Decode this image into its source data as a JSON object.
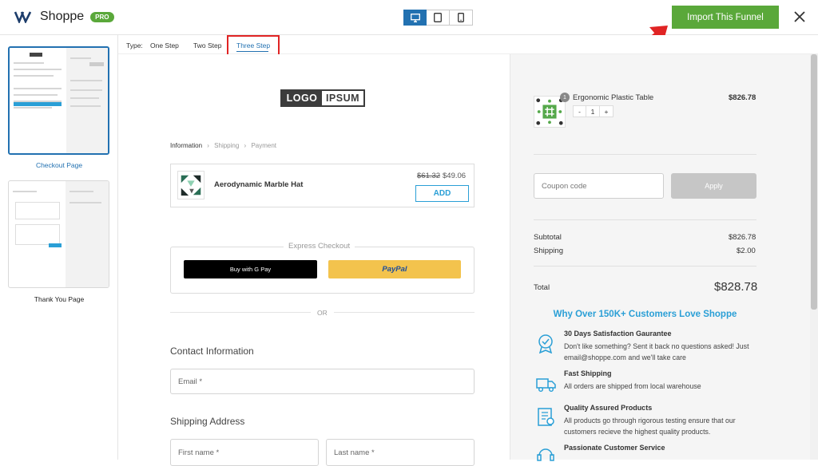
{
  "app": {
    "name": "Shoppe",
    "badge": "PRO"
  },
  "toolbar": {
    "import_label": "Import This Funnel"
  },
  "templates": [
    {
      "label": "Checkout Page",
      "selected": true
    },
    {
      "label": "Thank You Page",
      "selected": false
    }
  ],
  "typebar": {
    "label": "Type:",
    "tabs": [
      "One Step",
      "Two Step",
      "Three Step"
    ],
    "active_tab": "Three Step"
  },
  "preview": {
    "logo": {
      "left": "LOGO",
      "right": "IPSUM"
    },
    "breadcrumb": [
      "Information",
      "Shipping",
      "Payment"
    ],
    "offer": {
      "name": "Aerodynamic Marble Hat",
      "old_price": "$61.32",
      "new_price": "$49.06",
      "button": "ADD"
    },
    "express": {
      "label": "Express Checkout",
      "gpay": "Buy with G Pay",
      "paypal": "PayPal"
    },
    "or_text": "OR",
    "contact": {
      "title": "Contact Information",
      "email_placeholder": "Email *"
    },
    "shipping": {
      "title": "Shipping Address",
      "first_name": "First name *",
      "last_name": "Last name *"
    }
  },
  "summary": {
    "product": {
      "name": "Ergonomic Plastic Table",
      "price": "$826.78",
      "qty": "1",
      "minus": "-",
      "plus": "+"
    },
    "coupon_placeholder": "Coupon code",
    "apply_label": "Apply",
    "subtotal_label": "Subtotal",
    "subtotal": "$826.78",
    "shipping_label": "Shipping",
    "shipping": "$2.00",
    "total_label": "Total",
    "total": "$828.78"
  },
  "trust": {
    "title": "Why Over 150K+ Customers Love Shoppe",
    "features": [
      {
        "title": "30 Days Satisfaction Gaurantee",
        "desc": "Don't like something? Sent it back no questions asked! Just email@shoppe.com and we'll take care"
      },
      {
        "title": "Fast Shipping",
        "desc": "All orders are shipped from local warehouse"
      },
      {
        "title": "Quality Assured Products",
        "desc": "All products go through rigorous testing ensure that our customers recieve the highest quality products."
      },
      {
        "title": "Passionate Customer Service",
        "desc": ""
      }
    ]
  },
  "colors": {
    "brand_green": "#5aa83a",
    "accent_blue": "#2271b1",
    "link_blue": "#2a9fd6",
    "highlight_red": "#e02424"
  }
}
